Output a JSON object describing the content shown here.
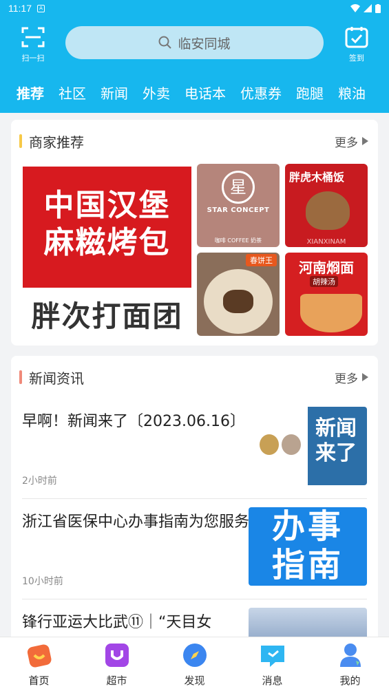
{
  "status_bar": {
    "time": "11:17",
    "sim": "A"
  },
  "header": {
    "scan_label": "扫一扫",
    "search_placeholder": "临安同城",
    "checkin_label": "签到",
    "tabs": [
      "推荐",
      "社区",
      "新闻",
      "外卖",
      "电话本",
      "优惠券",
      "跑腿",
      "粮油"
    ],
    "active_tab": "推荐",
    "colors": {
      "brand": "#17b7ee"
    }
  },
  "merchants": {
    "title": "商家推荐",
    "more": "更多",
    "bar_color": "#f7c948",
    "big": {
      "line1": "中国汉堡",
      "line2": "麻糍烤包",
      "below": "胖次打面团"
    },
    "tiles": [
      {
        "logo": "星",
        "brand": "STAR CONCEPT",
        "sub": "咖啡 COFFEE 奶茶"
      },
      {
        "title": "胖虎木桶饭",
        "sub": "XIANXINAM"
      },
      {
        "badge": "春饼王"
      },
      {
        "title": "河南烱面",
        "sub": "胡辣汤"
      }
    ]
  },
  "news": {
    "title": "新闻资讯",
    "more": "更多",
    "bar_color": "#f08a7a",
    "items": [
      {
        "title": "早啊！新闻来了〔2023.06.16〕",
        "time": "2小时前",
        "thumb_text": "新闻来了"
      },
      {
        "title": "浙江省医保中心办事指南为您服务",
        "time": "10小时前",
        "thumb_text": "办事指南"
      },
      {
        "title": "锋行亚运大比武⑪｜“天目女",
        "time": ""
      }
    ]
  },
  "bottom_nav": [
    {
      "label": "首页",
      "icon": "home-icon",
      "color": "#f26b3a"
    },
    {
      "label": "超市",
      "icon": "supermarket-icon",
      "color": "#a246e6"
    },
    {
      "label": "发现",
      "icon": "compass-icon",
      "color": "#3b86f0"
    },
    {
      "label": "消息",
      "icon": "message-icon",
      "color": "#2eb6f2"
    },
    {
      "label": "我的",
      "icon": "profile-icon",
      "color": "#4a8cf0"
    }
  ]
}
